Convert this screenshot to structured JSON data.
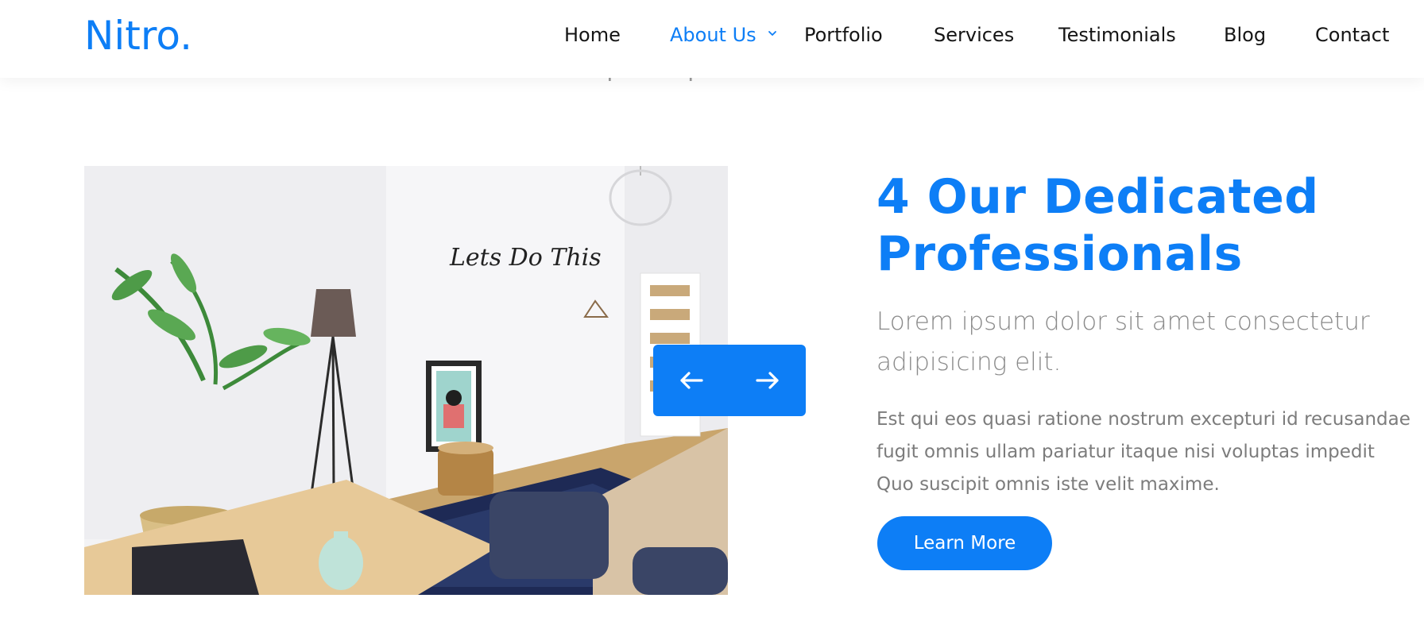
{
  "brand": {
    "logo": "Nitro.",
    "accent_color": "#0d7ef6"
  },
  "nav": {
    "items": [
      {
        "label": "Home"
      },
      {
        "label": "About Us",
        "active": true,
        "has_dropdown": true
      },
      {
        "label": "Portfolio"
      },
      {
        "label": "Services"
      },
      {
        "label": "Testimonials"
      },
      {
        "label": "Blog"
      },
      {
        "label": "Contact"
      }
    ]
  },
  "section": {
    "partial_subtitle": "Neque tempora reiciendis.",
    "heading_line1": "4 Our Dedicated",
    "heading_line2": "Professionals",
    "lead": "Lorem ipsum dolor sit amet consectetur adipisicing elit.",
    "body": "Est qui eos quasi ratione nostrum excepturi id recusandae fugit omnis ullam pariatur itaque nisi voluptas impedit Quo suscipit omnis iste velit maxime.",
    "cta_label": "Learn More"
  },
  "slider": {
    "prev_icon": "arrow-left-icon",
    "next_icon": "arrow-right-icon"
  },
  "photo": {
    "wall_lettering": "Lets Do This"
  }
}
